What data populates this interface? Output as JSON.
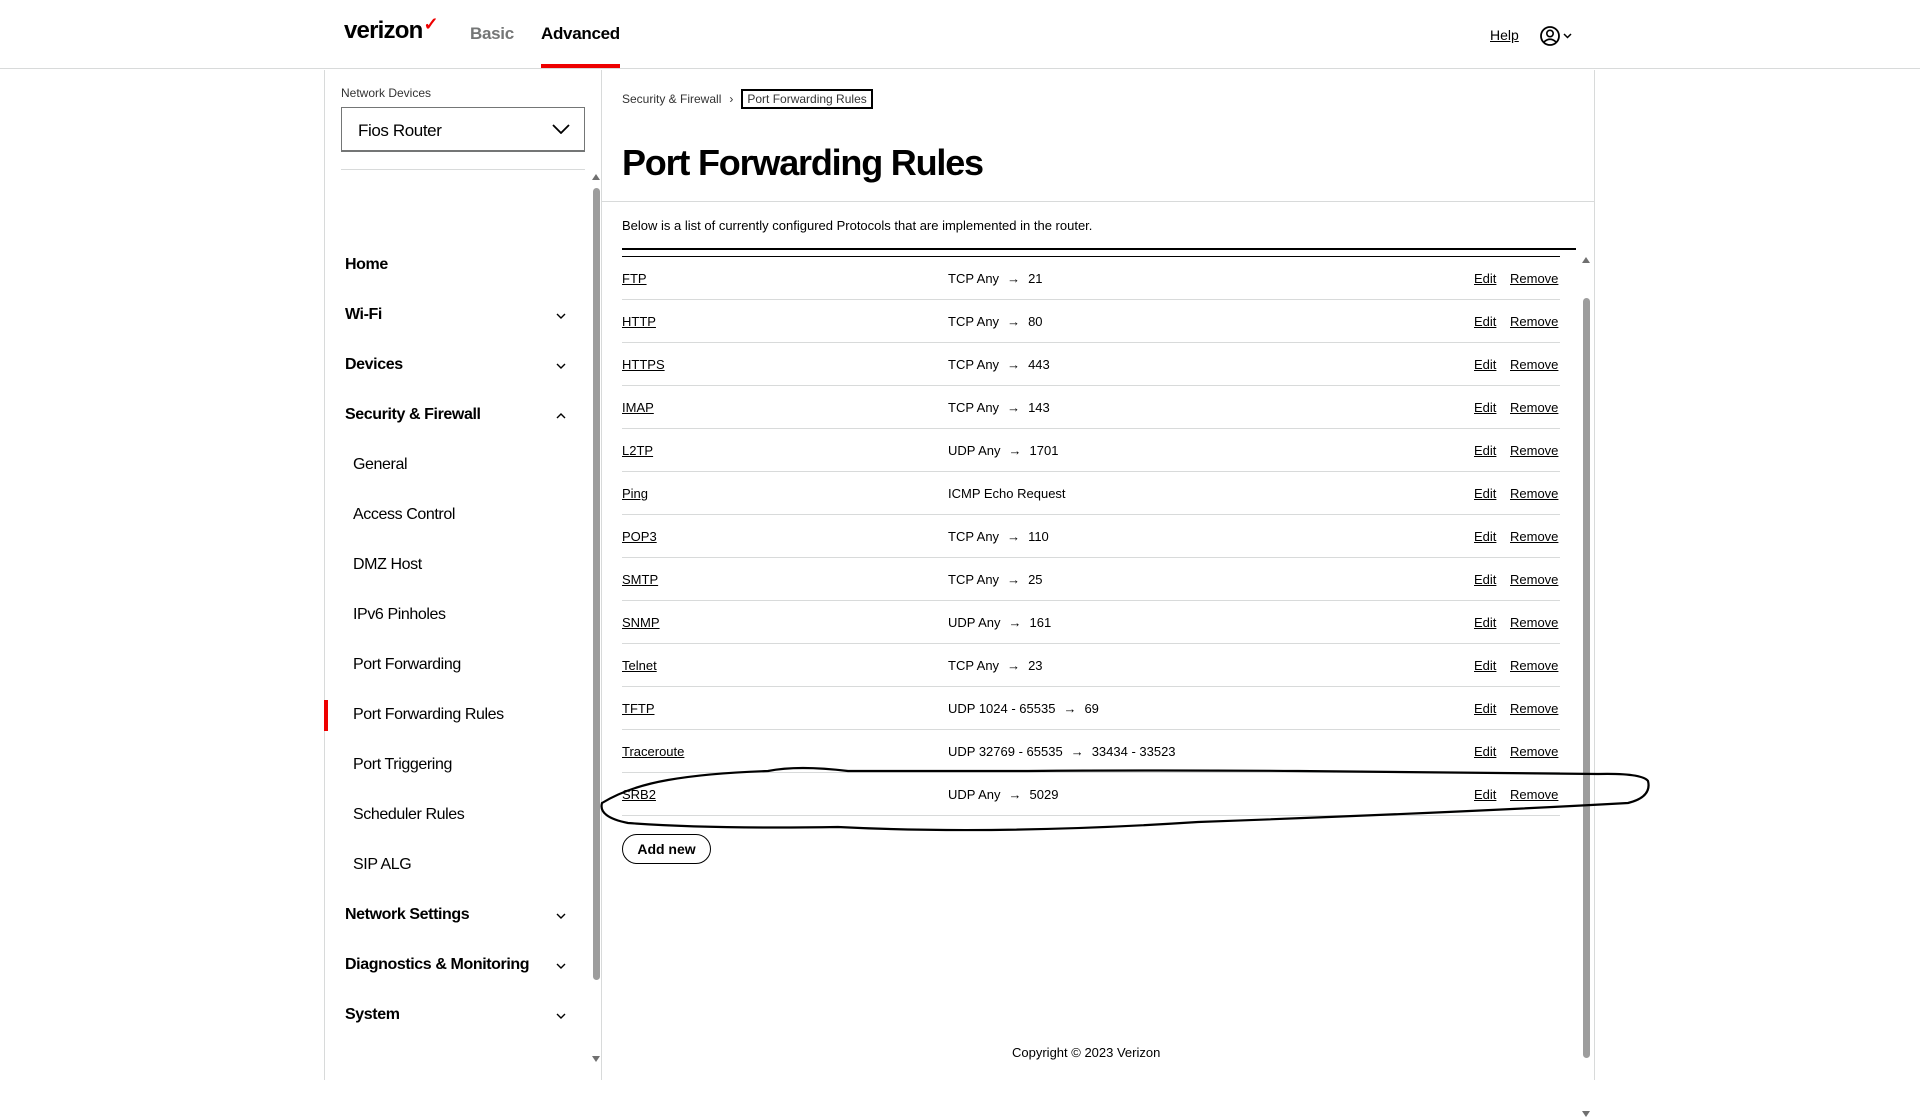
{
  "header": {
    "logo": "verizon",
    "logo_mark": "✓",
    "tabs": [
      "Basic",
      "Advanced"
    ],
    "active_tab": "Advanced",
    "help": "Help",
    "user_icon": "user-circle-icon"
  },
  "sidebar": {
    "network_devices_label": "Network Devices",
    "device_selected": "Fios Router",
    "menu": {
      "home": "Home",
      "wifi": "Wi-Fi",
      "devices": "Devices",
      "security": "Security & Firewall",
      "sub": [
        "General",
        "Access Control",
        "DMZ Host",
        "IPv6 Pinholes",
        "Port Forwarding",
        "Port Forwarding Rules",
        "Port Triggering",
        "Scheduler Rules",
        "SIP ALG"
      ],
      "network_settings": "Network Settings",
      "diagnostics": "Diagnostics & Monitoring",
      "system": "System"
    },
    "active_item": "Port Forwarding Rules"
  },
  "main": {
    "breadcrumb": [
      "Security & Firewall",
      "Port Forwarding Rules"
    ],
    "title": "Port Forwarding Rules",
    "description": "Below is a list of currently configured Protocols that are implemented in the router.",
    "edit_label": "Edit",
    "remove_label": "Remove",
    "rules": [
      {
        "name": "FTP",
        "from": "TCP Any",
        "to": "21"
      },
      {
        "name": "HTTP",
        "from": "TCP Any",
        "to": "80"
      },
      {
        "name": "HTTPS",
        "from": "TCP Any",
        "to": "443"
      },
      {
        "name": "IMAP",
        "from": "TCP Any",
        "to": "143"
      },
      {
        "name": "L2TP",
        "from": "UDP Any",
        "to": "1701"
      },
      {
        "name": "Ping",
        "from": "ICMP Echo Request",
        "to": ""
      },
      {
        "name": "POP3",
        "from": "TCP Any",
        "to": "110"
      },
      {
        "name": "SMTP",
        "from": "TCP Any",
        "to": "25"
      },
      {
        "name": "SNMP",
        "from": "UDP Any",
        "to": "161"
      },
      {
        "name": "Telnet",
        "from": "TCP Any",
        "to": "23"
      },
      {
        "name": "TFTP",
        "from": "UDP 1024 - 65535",
        "to": "69"
      },
      {
        "name": "Traceroute",
        "from": "UDP 32769 - 65535",
        "to": "33434 - 33523"
      },
      {
        "name": "SRB2",
        "from": "UDP Any",
        "to": "5029"
      }
    ],
    "add_button": "Add new",
    "copyright": "Copyright © 2023 Verizon"
  },
  "colors": {
    "accent": "#ee0000",
    "border": "#d8dada",
    "muted": "#747676"
  }
}
